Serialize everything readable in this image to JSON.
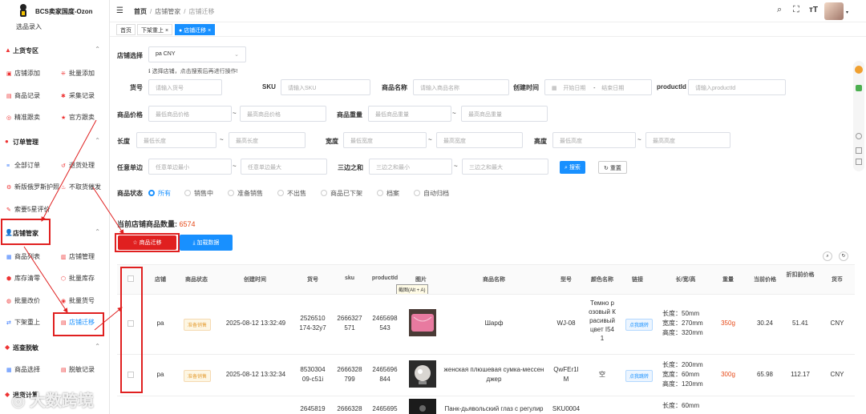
{
  "app": {
    "title": "BCS卖家国度-Ozon"
  },
  "sidebar": {
    "top_item": "选品录入",
    "sections": [
      {
        "label": "上货专区",
        "items": [
          "店铺添加",
          "批量添加",
          "商品记录",
          "采集记录",
          "精准跟卖",
          "官方跟卖"
        ]
      },
      {
        "label": "订单管理",
        "items": [
          "全部订单",
          "退货处理",
          "新版俄罗斯护照",
          "不取货催发",
          "索要5星评价"
        ]
      },
      {
        "label": "店铺管家",
        "items": [
          "商品列表",
          "店铺管理",
          "库存清零",
          "批量库存",
          "批量改价",
          "批量货号",
          "下架重上",
          "店铺迁移"
        ]
      },
      {
        "label": "巡查脱敏",
        "items": [
          "商品选择",
          "脱敏记录"
        ]
      },
      {
        "label": "退货计算"
      }
    ]
  },
  "header": {
    "breadcrumb": [
      "首页",
      "店铺管家",
      "店铺迁移"
    ]
  },
  "tabs": [
    "首页",
    "下架重上",
    "店铺迁移"
  ],
  "form": {
    "store_label": "店铺选择",
    "store_value": "pa CNY",
    "store_hint": "选择店铺，点击搜索后再进行操作!",
    "sku_no_label": "货号",
    "sku_no_ph": "请输入货号",
    "sku_label": "SKU",
    "sku_ph": "请输入SKU",
    "name_label": "商品名称",
    "name_ph": "请输入商品名称",
    "created_label": "创建时间",
    "start_ph": "开始日期",
    "end_ph": "结束日期",
    "range_sep": "-",
    "pid_label": "productId",
    "pid_ph": "请输入productId",
    "price_label": "商品价格",
    "price_min": "最低商品价格",
    "price_max": "最高商品价格",
    "weight_label": "商品重量",
    "weight_min": "最低商品重量",
    "weight_max": "最高商品重量",
    "len_label": "长度",
    "len_min": "最低长度",
    "len_max": "最高长度",
    "wid_label": "宽度",
    "wid_min": "最低宽度",
    "wid_max": "最高宽度",
    "hei_label": "高度",
    "hei_min": "最低高度",
    "hei_max": "最高高度",
    "side_label": "任意单边",
    "side_min": "任意单边最小",
    "side_max": "任意单边最大",
    "sum_label": "三边之和",
    "sum_min": "三边之和最小",
    "sum_max": "三边之和最大",
    "tilde": "~",
    "search_btn": "搜索",
    "reset_btn": "重置",
    "status_label": "商品状态",
    "status_options": [
      "所有",
      "销售中",
      "准备销售",
      "不出售",
      "商品已下架",
      "档案",
      "自动归档"
    ]
  },
  "summary": {
    "count_label": "当前店铺商品数量:",
    "count": "6574"
  },
  "actions": {
    "migrate": "商品迁移",
    "load": "加载数据"
  },
  "tooltip": "截图(Alt + A)",
  "table": {
    "headers": [
      "店铺",
      "商品状态",
      "创建时间",
      "货号",
      "sku",
      "productId",
      "图片",
      "商品名称",
      "型号",
      "颜色名称",
      "链接",
      "长/宽/高",
      "重量",
      "当前价格",
      "折扣前价格",
      "货币"
    ],
    "rows": [
      {
        "store": "pa",
        "status": "准备销售",
        "created": "2025-08-12 13:32:49",
        "sku_no": [
          "2526510",
          "174-32y7"
        ],
        "sku": [
          "2666327",
          "571"
        ],
        "pid": [
          "2465698",
          "543"
        ],
        "name": [
          "Шарф"
        ],
        "model": [
          "WJ-08"
        ],
        "color": [
          "Темно р",
          "озовый К",
          "расивый",
          "цвет I54",
          "1"
        ],
        "link": "点我跳转",
        "dims": [
          "长度：50mm",
          "宽度：270mm",
          "高度：320mm"
        ],
        "weight": "350g",
        "price": "30.24",
        "orig": "51.41",
        "cur": "CNY"
      },
      {
        "store": "pa",
        "status": "准备销售",
        "created": "2025-08-12 13:32:34",
        "sku_no": [
          "8530304",
          "09-c51i"
        ],
        "sku": [
          "2666328",
          "799"
        ],
        "pid": [
          "2465696",
          "844"
        ],
        "name": [
          "женская плюшевая сумка-мессен",
          "джер"
        ],
        "model": [
          "QwFEr1I",
          "M"
        ],
        "color": [
          "空"
        ],
        "link": "点我跳转",
        "dims": [
          "长度：200mm",
          "宽度：60mm",
          "高度：120mm"
        ],
        "weight": "300g",
        "price": "65.98",
        "orig": "112.17",
        "cur": "CNY"
      },
      {
        "store": "",
        "status": "",
        "created": "",
        "sku_no": [
          "2645819"
        ],
        "sku": [
          "2666328"
        ],
        "pid": [
          "2465695"
        ],
        "name": [
          "Панк-дьявольский глаз с регулир"
        ],
        "model": [
          "SKU0004"
        ],
        "color": [],
        "link": "",
        "dims": [
          "长度：60mm"
        ],
        "weight": "",
        "price": "",
        "orig": "",
        "cur": ""
      }
    ]
  },
  "watermark": "大数跨境",
  "colors": {
    "accent": "#1890ff",
    "danger": "#e02020",
    "warning": "#e6a23c"
  }
}
